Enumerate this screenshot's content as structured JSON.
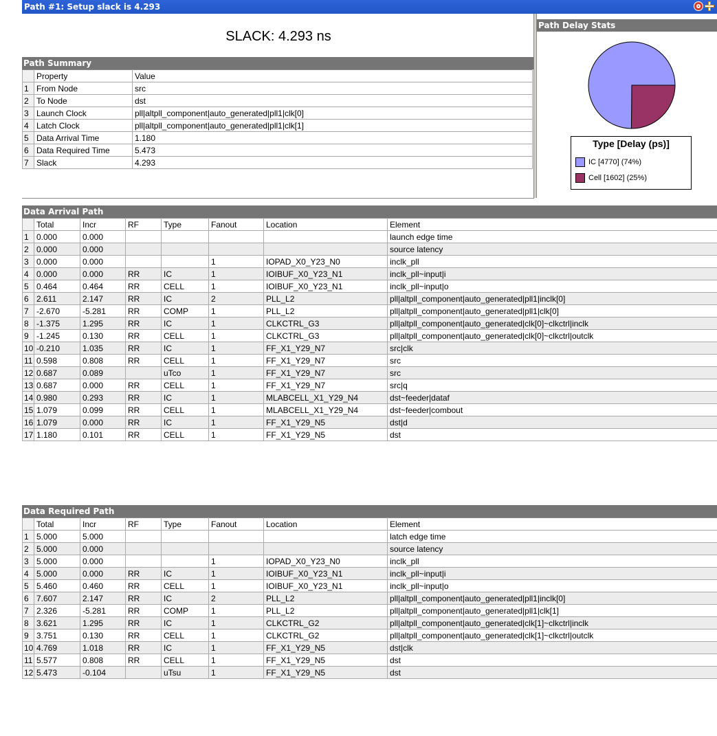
{
  "window": {
    "title": "Path #1: Setup slack is 4.293"
  },
  "slack_label": "SLACK: 4.293 ns",
  "path_summary": {
    "header": "Path Summary",
    "columns": [
      "Property",
      "Value"
    ],
    "rows": [
      [
        "1",
        "From Node",
        "src"
      ],
      [
        "2",
        "To Node",
        "dst"
      ],
      [
        "3",
        "Launch Clock",
        "pll|altpll_component|auto_generated|pll1|clk[0]"
      ],
      [
        "4",
        "Latch Clock",
        "pll|altpll_component|auto_generated|pll1|clk[1]"
      ],
      [
        "5",
        "Data Arrival Time",
        "1.180"
      ],
      [
        "6",
        "Data Required Time",
        "5.473"
      ],
      [
        "7",
        "Slack",
        "4.293"
      ]
    ]
  },
  "delay_stats": {
    "header": "Path Delay Stats",
    "legend_title": "Type [Delay (ps)]",
    "colors": {
      "ic": "#9999ff",
      "cell": "#993366"
    }
  },
  "chart_data": {
    "type": "pie",
    "title": "Type [Delay (ps)]",
    "categories": [
      "IC",
      "Cell"
    ],
    "values": [
      4770,
      1602
    ],
    "percentages": [
      74,
      25
    ],
    "legend_labels": [
      "IC [4770] (74%)",
      "Cell [1602] (25%)"
    ]
  },
  "data_arrival": {
    "header": "Data Arrival Path",
    "columns": [
      "Total",
      "Incr",
      "RF",
      "Type",
      "Fanout",
      "Location",
      "Element"
    ],
    "rows": [
      [
        "1",
        "0.000",
        "0.000",
        "",
        "",
        "",
        "",
        "launch edge time"
      ],
      [
        "2",
        "0.000",
        "0.000",
        "",
        "",
        "",
        "",
        "source latency"
      ],
      [
        "3",
        "0.000",
        "0.000",
        "",
        "",
        "1",
        "IOPAD_X0_Y23_N0",
        "inclk_pll"
      ],
      [
        "4",
        "0.000",
        "0.000",
        "RR",
        "IC",
        "1",
        "IOIBUF_X0_Y23_N1",
        "inclk_pll~input|i"
      ],
      [
        "5",
        "0.464",
        "0.464",
        "RR",
        "CELL",
        "1",
        "IOIBUF_X0_Y23_N1",
        "inclk_pll~input|o"
      ],
      [
        "6",
        "2.611",
        "2.147",
        "RR",
        "IC",
        "2",
        "PLL_L2",
        "pll|altpll_component|auto_generated|pll1|inclk[0]"
      ],
      [
        "7",
        "-2.670",
        "-5.281",
        "RR",
        "COMP",
        "1",
        "PLL_L2",
        "pll|altpll_component|auto_generated|pll1|clk[0]"
      ],
      [
        "8",
        "-1.375",
        "1.295",
        "RR",
        "IC",
        "1",
        "CLKCTRL_G3",
        "pll|altpll_component|auto_generated|clk[0]~clkctrl|inclk"
      ],
      [
        "9",
        "-1.245",
        "0.130",
        "RR",
        "CELL",
        "1",
        "CLKCTRL_G3",
        "pll|altpll_component|auto_generated|clk[0]~clkctrl|outclk"
      ],
      [
        "10",
        "-0.210",
        "1.035",
        "RR",
        "IC",
        "1",
        "FF_X1_Y29_N7",
        "src|clk"
      ],
      [
        "11",
        "0.598",
        "0.808",
        "RR",
        "CELL",
        "1",
        "FF_X1_Y29_N7",
        "src"
      ],
      [
        "12",
        "0.687",
        "0.089",
        "",
        "uTco",
        "1",
        "FF_X1_Y29_N7",
        "src"
      ],
      [
        "13",
        "0.687",
        "0.000",
        "RR",
        "CELL",
        "1",
        "FF_X1_Y29_N7",
        "src|q"
      ],
      [
        "14",
        "0.980",
        "0.293",
        "RR",
        "IC",
        "1",
        "MLABCELL_X1_Y29_N4",
        "dst~feeder|dataf"
      ],
      [
        "15",
        "1.079",
        "0.099",
        "RR",
        "CELL",
        "1",
        "MLABCELL_X1_Y29_N4",
        "dst~feeder|combout"
      ],
      [
        "16",
        "1.079",
        "0.000",
        "RR",
        "IC",
        "1",
        "FF_X1_Y29_N5",
        "dst|d"
      ],
      [
        "17",
        "1.180",
        "0.101",
        "RR",
        "CELL",
        "1",
        "FF_X1_Y29_N5",
        "dst"
      ]
    ]
  },
  "data_required": {
    "header": "Data Required Path",
    "columns": [
      "Total",
      "Incr",
      "RF",
      "Type",
      "Fanout",
      "Location",
      "Element"
    ],
    "rows": [
      [
        "1",
        "5.000",
        "5.000",
        "",
        "",
        "",
        "",
        "latch edge time"
      ],
      [
        "2",
        "5.000",
        "0.000",
        "",
        "",
        "",
        "",
        "source latency"
      ],
      [
        "3",
        "5.000",
        "0.000",
        "",
        "",
        "1",
        "IOPAD_X0_Y23_N0",
        "inclk_pll"
      ],
      [
        "4",
        "5.000",
        "0.000",
        "RR",
        "IC",
        "1",
        "IOIBUF_X0_Y23_N1",
        "inclk_pll~input|i"
      ],
      [
        "5",
        "5.460",
        "0.460",
        "RR",
        "CELL",
        "1",
        "IOIBUF_X0_Y23_N1",
        "inclk_pll~input|o"
      ],
      [
        "6",
        "7.607",
        "2.147",
        "RR",
        "IC",
        "2",
        "PLL_L2",
        "pll|altpll_component|auto_generated|pll1|inclk[0]"
      ],
      [
        "7",
        "2.326",
        "-5.281",
        "RR",
        "COMP",
        "1",
        "PLL_L2",
        "pll|altpll_component|auto_generated|pll1|clk[1]"
      ],
      [
        "8",
        "3.621",
        "1.295",
        "RR",
        "IC",
        "1",
        "CLKCTRL_G2",
        "pll|altpll_component|auto_generated|clk[1]~clkctrl|inclk"
      ],
      [
        "9",
        "3.751",
        "0.130",
        "RR",
        "CELL",
        "1",
        "CLKCTRL_G2",
        "pll|altpll_component|auto_generated|clk[1]~clkctrl|outclk"
      ],
      [
        "10",
        "4.769",
        "1.018",
        "RR",
        "IC",
        "1",
        "FF_X1_Y29_N5",
        "dst|clk"
      ],
      [
        "11",
        "5.577",
        "0.808",
        "RR",
        "CELL",
        "1",
        "FF_X1_Y29_N5",
        "dst"
      ],
      [
        "12",
        "5.473",
        "-0.104",
        "",
        "uTsu",
        "1",
        "FF_X1_Y29_N5",
        "dst"
      ]
    ]
  }
}
